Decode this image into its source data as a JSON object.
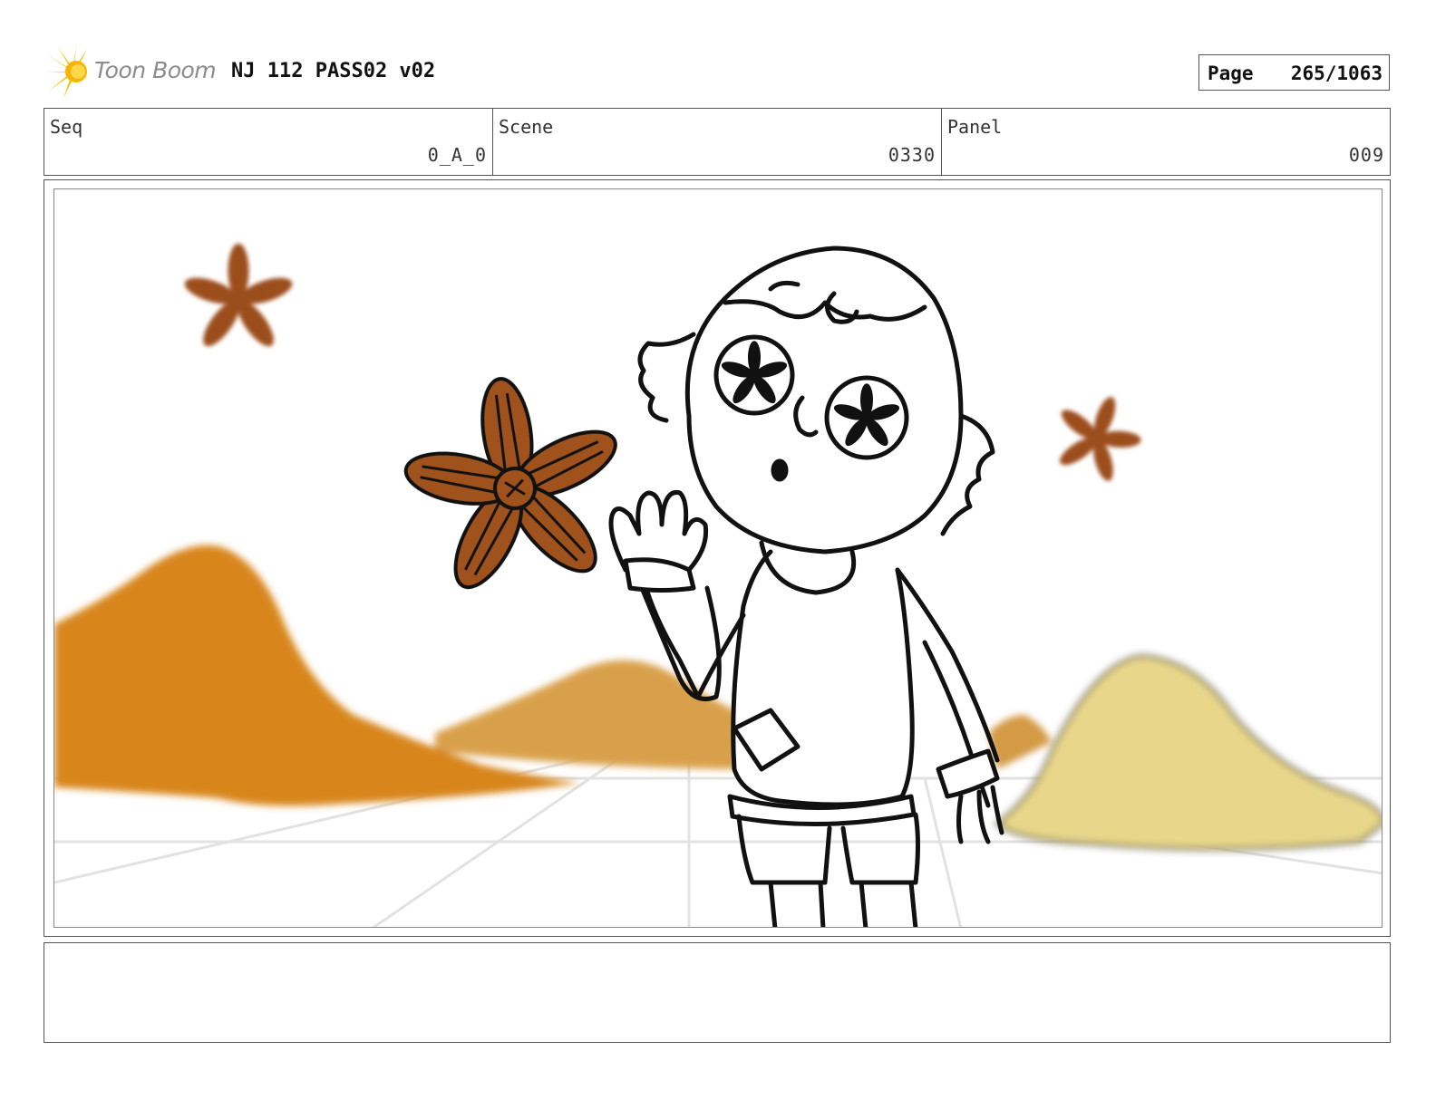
{
  "header": {
    "logo_text": "Toon Boom",
    "title": "NJ 112 PASS02 v02",
    "page_label": "Page",
    "page_number": "265/1063"
  },
  "info": {
    "seq_label": "Seq",
    "seq_value": "0_A_0",
    "scene_label": "Scene",
    "scene_value": "0330",
    "panel_label": "Panel",
    "panel_value": "009"
  },
  "colors": {
    "mountain_left": "#d8861f",
    "mountain_mid": "#d9a04c",
    "mountain_right": "#e8d78b",
    "flower_brown": "#a0521c",
    "logo_yellow": "#f5c400",
    "line": "#111111"
  },
  "caption": {
    "text": ""
  }
}
